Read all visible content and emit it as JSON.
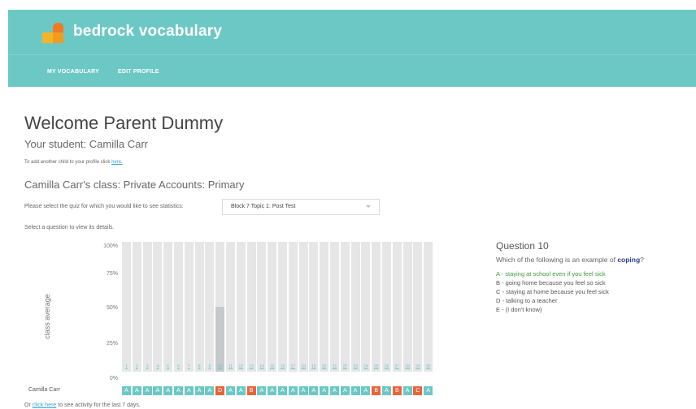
{
  "brand": {
    "name": "bedrock vocabulary"
  },
  "nav": {
    "my_vocabulary": "MY VOCABULARY",
    "edit_profile": "EDIT PROFILE"
  },
  "page": {
    "welcome": "Welcome Parent Dummy",
    "student": "Your student: Camilla Carr",
    "add_child_prefix": "To add another child to your profile click",
    "add_child_link": "here.",
    "class_line": "Camilla Carr's class: Private Accounts: Primary",
    "select_label": "Please select the quiz for which you would like to see statistics:",
    "selected_quiz": "Block 7 Topic 1: Post Test",
    "select_question": "Select a question to view its details."
  },
  "chart": {
    "y_title": "class average",
    "y_ticks": [
      "100%",
      "75%",
      "50%",
      "25%",
      "0%"
    ],
    "student_name": "Camilla Carr",
    "questions": [
      {
        "n": "1",
        "avg": 100,
        "ans": "A",
        "ok": true
      },
      {
        "n": "2",
        "avg": 100,
        "ans": "A",
        "ok": true
      },
      {
        "n": "3",
        "avg": 100,
        "ans": "A",
        "ok": true
      },
      {
        "n": "4",
        "avg": 100,
        "ans": "A",
        "ok": true
      },
      {
        "n": "5",
        "avg": 100,
        "ans": "A",
        "ok": true
      },
      {
        "n": "6",
        "avg": 100,
        "ans": "A",
        "ok": true
      },
      {
        "n": "7",
        "avg": 100,
        "ans": "A",
        "ok": true
      },
      {
        "n": "8",
        "avg": 100,
        "ans": "A",
        "ok": true
      },
      {
        "n": "9",
        "avg": 100,
        "ans": "A",
        "ok": true
      },
      {
        "n": "10",
        "avg": 50,
        "ans": "D",
        "ok": false
      },
      {
        "n": "11",
        "avg": 100,
        "ans": "A",
        "ok": true
      },
      {
        "n": "12",
        "avg": 100,
        "ans": "A",
        "ok": true
      },
      {
        "n": "13",
        "avg": 50,
        "ans": "B",
        "ok": false
      },
      {
        "n": "14",
        "avg": 100,
        "ans": "A",
        "ok": true
      },
      {
        "n": "15",
        "avg": 100,
        "ans": "A",
        "ok": true
      },
      {
        "n": "16",
        "avg": 100,
        "ans": "A",
        "ok": true
      },
      {
        "n": "17",
        "avg": 100,
        "ans": "A",
        "ok": true
      },
      {
        "n": "18",
        "avg": 100,
        "ans": "A",
        "ok": true
      },
      {
        "n": "19",
        "avg": 100,
        "ans": "A",
        "ok": true
      },
      {
        "n": "20",
        "avg": 100,
        "ans": "A",
        "ok": true
      },
      {
        "n": "21",
        "avg": 100,
        "ans": "A",
        "ok": true
      },
      {
        "n": "22",
        "avg": 100,
        "ans": "A",
        "ok": true
      },
      {
        "n": "23",
        "avg": 100,
        "ans": "A",
        "ok": true
      },
      {
        "n": "24",
        "avg": 100,
        "ans": "A",
        "ok": true
      },
      {
        "n": "25",
        "avg": 50,
        "ans": "B",
        "ok": false
      },
      {
        "n": "26",
        "avg": 100,
        "ans": "A",
        "ok": true
      },
      {
        "n": "27",
        "avg": 50,
        "ans": "B",
        "ok": false
      },
      {
        "n": "28",
        "avg": 100,
        "ans": "A",
        "ok": true
      },
      {
        "n": "29",
        "avg": 50,
        "ans": "C",
        "ok": false
      },
      {
        "n": "30",
        "avg": 100,
        "ans": "A",
        "ok": true
      }
    ],
    "selected_question": "10"
  },
  "question": {
    "title": "Question 10",
    "text_prefix": "Which of the following is an example of",
    "keyword": "coping",
    "text_suffix": "?",
    "options": [
      {
        "text": "A - staying at school even if you feel sick",
        "correct": true
      },
      {
        "text": "B - going home because you feel so sick",
        "correct": false
      },
      {
        "text": "C - staying at home because you feel sick",
        "correct": false
      },
      {
        "text": "D - talking to a teacher",
        "correct": false
      },
      {
        "text": "E - (I don't know)",
        "correct": false
      }
    ]
  },
  "footer": {
    "prefix": "Or",
    "link": "click here",
    "suffix": "to see activity for the last 7 days."
  },
  "colors": {
    "header": "#6cc8c5",
    "correct": "#6cc8c5",
    "wrong": "#e8643a",
    "bar": "#e6e6e6",
    "bar_selected": "#c5c9cc"
  }
}
